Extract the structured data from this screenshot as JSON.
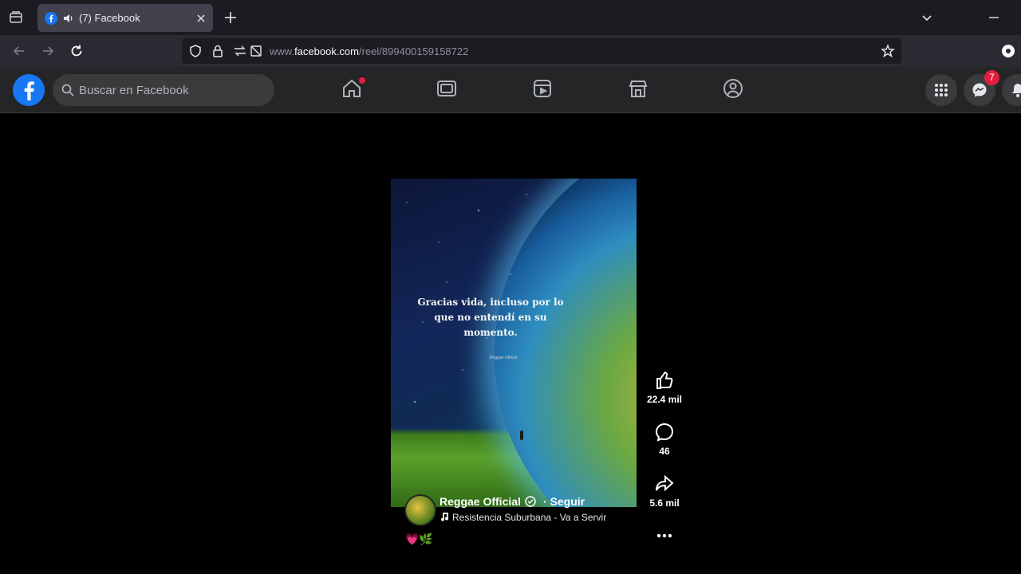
{
  "browser": {
    "tab_title": "(7) Facebook",
    "url_prefix": "www.",
    "url_domain": "facebook.com",
    "url_path": "/reel/899400159158722"
  },
  "facebook": {
    "search_placeholder": "Buscar en Facebook",
    "nav_items": [
      "home-icon",
      "watch-icon",
      "reels-icon",
      "marketplace-icon",
      "groups-icon"
    ],
    "messenger_badge": "7"
  },
  "reel": {
    "quote": "Gracias vida, incluso por lo que no entendí en su momento.",
    "signature": "Reggae Official",
    "page_name": "Reggae Official",
    "follow_label": "· Seguir",
    "song": "Resistencia Suburbana - Va a Servir",
    "emojis": "💗🌿",
    "likes": "22.4 mil",
    "comments": "46",
    "shares": "5.6 mil"
  },
  "colors": {
    "fb_blue": "#1877f2",
    "badge_red": "#e41e3f",
    "header_bg": "#242526"
  }
}
